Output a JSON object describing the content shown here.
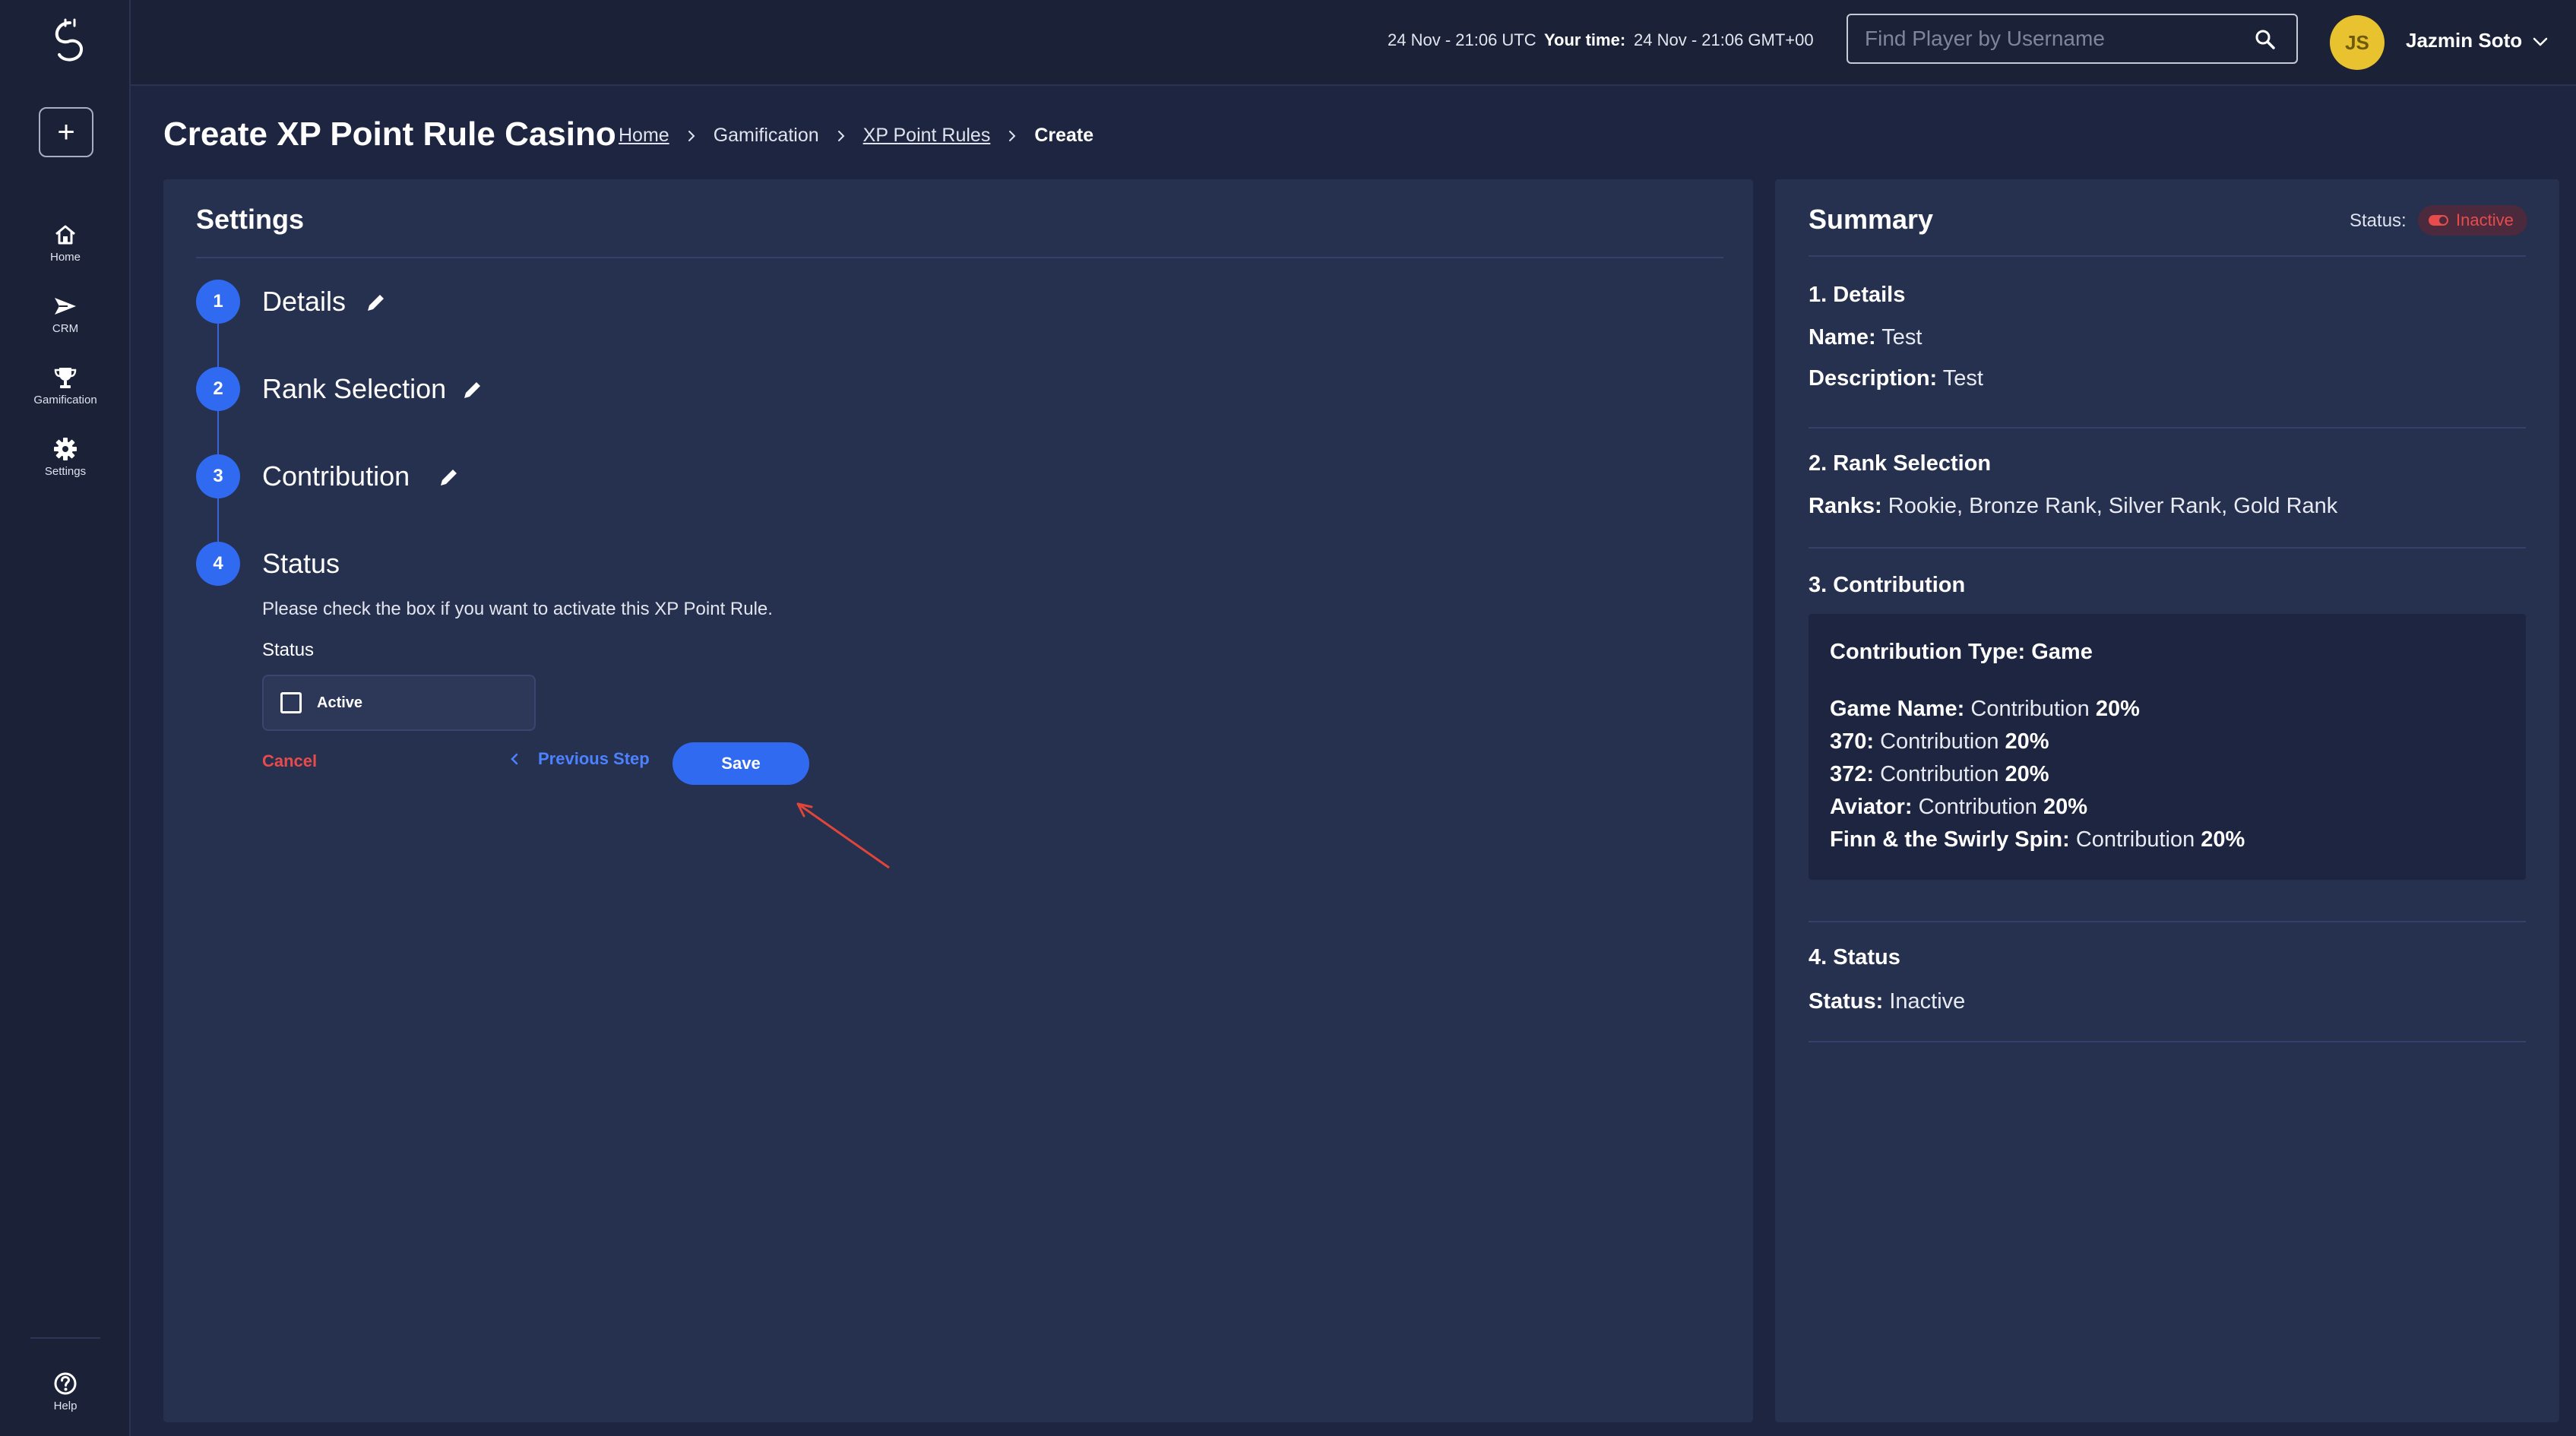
{
  "sidebar": {
    "items": [
      {
        "label": "Home",
        "icon": "home-icon"
      },
      {
        "label": "CRM",
        "icon": "send-icon"
      },
      {
        "label": "Gamification",
        "icon": "trophy-icon"
      },
      {
        "label": "Settings",
        "icon": "gear-icon"
      }
    ],
    "help": {
      "label": "Help",
      "icon": "help-icon"
    }
  },
  "header": {
    "server_time": "24 Nov - 21:06 UTC",
    "your_time_label": "Your time:",
    "your_time": "24 Nov - 21:06 GMT+00",
    "search_placeholder": "Find Player by Username",
    "user_initials": "JS",
    "user_name": "Jazmin Soto"
  },
  "page": {
    "title": "Create XP Point Rule Casino",
    "breadcrumb": [
      "Home",
      "Gamification",
      "XP Point Rules",
      "Create"
    ]
  },
  "settings": {
    "title": "Settings",
    "steps": [
      {
        "number": "1",
        "title": "Details"
      },
      {
        "number": "2",
        "title": "Rank Selection"
      },
      {
        "number": "3",
        "title": "Contribution"
      },
      {
        "number": "4",
        "title": "Status"
      }
    ],
    "status_description": "Please check the box if you want to activate this XP Point Rule.",
    "status_field_label": "Status",
    "checkbox_label": "Active",
    "checkbox_checked": false,
    "cancel_label": "Cancel",
    "previous_label": "Previous Step",
    "save_label": "Save"
  },
  "summary": {
    "title": "Summary",
    "status_label": "Status:",
    "status_badge": "Inactive",
    "details": {
      "heading": "1. Details",
      "name_label": "Name:",
      "name_value": "Test",
      "description_label": "Description:",
      "description_value": "Test"
    },
    "rank_selection": {
      "heading": "2. Rank Selection",
      "ranks_label": "Ranks:",
      "ranks_value": "Rookie, Bronze Rank, Silver Rank, Gold Rank"
    },
    "contribution": {
      "heading": "3. Contribution",
      "type_text": "Contribution Type: Game",
      "items": [
        {
          "name": "Game Name:",
          "prefix": "Contribution",
          "value": "20%"
        },
        {
          "name": "370:",
          "prefix": "Contribution",
          "value": "20%"
        },
        {
          "name": "372:",
          "prefix": "Contribution",
          "value": "20%"
        },
        {
          "name": "Aviator:",
          "prefix": "Contribution",
          "value": "20%"
        },
        {
          "name": "Finn & the Swirly Spin:",
          "prefix": "Contribution",
          "value": "20%"
        }
      ]
    },
    "status": {
      "heading": "4. Status",
      "status_label": "Status:",
      "status_value": "Inactive"
    }
  },
  "colors": {
    "background": "#1d2540",
    "panel": "#26304f",
    "accent": "#2f6af0",
    "danger": "#e84b4b",
    "avatar": "#e8c22f"
  }
}
